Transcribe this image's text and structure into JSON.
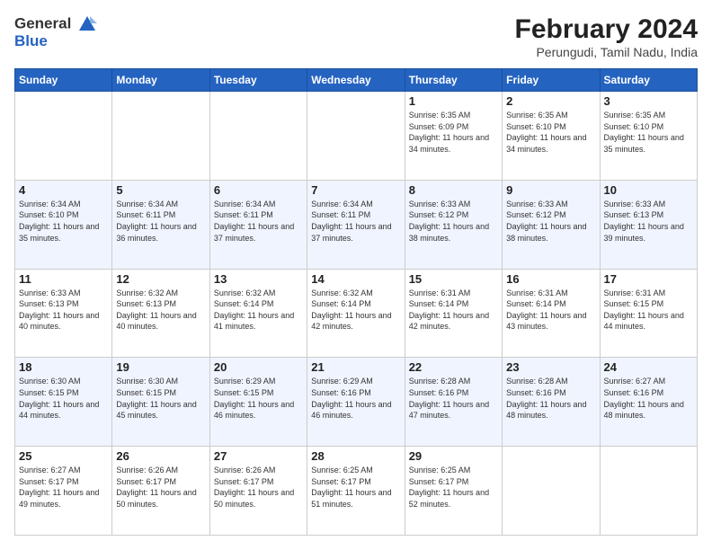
{
  "header": {
    "logo_line1": "General",
    "logo_line2": "Blue",
    "title": "February 2024",
    "subtitle": "Perungudi, Tamil Nadu, India"
  },
  "weekdays": [
    "Sunday",
    "Monday",
    "Tuesday",
    "Wednesday",
    "Thursday",
    "Friday",
    "Saturday"
  ],
  "weeks": [
    [
      {
        "day": "",
        "info": ""
      },
      {
        "day": "",
        "info": ""
      },
      {
        "day": "",
        "info": ""
      },
      {
        "day": "",
        "info": ""
      },
      {
        "day": "1",
        "info": "Sunrise: 6:35 AM\nSunset: 6:09 PM\nDaylight: 11 hours and 34 minutes."
      },
      {
        "day": "2",
        "info": "Sunrise: 6:35 AM\nSunset: 6:10 PM\nDaylight: 11 hours and 34 minutes."
      },
      {
        "day": "3",
        "info": "Sunrise: 6:35 AM\nSunset: 6:10 PM\nDaylight: 11 hours and 35 minutes."
      }
    ],
    [
      {
        "day": "4",
        "info": "Sunrise: 6:34 AM\nSunset: 6:10 PM\nDaylight: 11 hours and 35 minutes."
      },
      {
        "day": "5",
        "info": "Sunrise: 6:34 AM\nSunset: 6:11 PM\nDaylight: 11 hours and 36 minutes."
      },
      {
        "day": "6",
        "info": "Sunrise: 6:34 AM\nSunset: 6:11 PM\nDaylight: 11 hours and 37 minutes."
      },
      {
        "day": "7",
        "info": "Sunrise: 6:34 AM\nSunset: 6:11 PM\nDaylight: 11 hours and 37 minutes."
      },
      {
        "day": "8",
        "info": "Sunrise: 6:33 AM\nSunset: 6:12 PM\nDaylight: 11 hours and 38 minutes."
      },
      {
        "day": "9",
        "info": "Sunrise: 6:33 AM\nSunset: 6:12 PM\nDaylight: 11 hours and 38 minutes."
      },
      {
        "day": "10",
        "info": "Sunrise: 6:33 AM\nSunset: 6:13 PM\nDaylight: 11 hours and 39 minutes."
      }
    ],
    [
      {
        "day": "11",
        "info": "Sunrise: 6:33 AM\nSunset: 6:13 PM\nDaylight: 11 hours and 40 minutes."
      },
      {
        "day": "12",
        "info": "Sunrise: 6:32 AM\nSunset: 6:13 PM\nDaylight: 11 hours and 40 minutes."
      },
      {
        "day": "13",
        "info": "Sunrise: 6:32 AM\nSunset: 6:14 PM\nDaylight: 11 hours and 41 minutes."
      },
      {
        "day": "14",
        "info": "Sunrise: 6:32 AM\nSunset: 6:14 PM\nDaylight: 11 hours and 42 minutes."
      },
      {
        "day": "15",
        "info": "Sunrise: 6:31 AM\nSunset: 6:14 PM\nDaylight: 11 hours and 42 minutes."
      },
      {
        "day": "16",
        "info": "Sunrise: 6:31 AM\nSunset: 6:14 PM\nDaylight: 11 hours and 43 minutes."
      },
      {
        "day": "17",
        "info": "Sunrise: 6:31 AM\nSunset: 6:15 PM\nDaylight: 11 hours and 44 minutes."
      }
    ],
    [
      {
        "day": "18",
        "info": "Sunrise: 6:30 AM\nSunset: 6:15 PM\nDaylight: 11 hours and 44 minutes."
      },
      {
        "day": "19",
        "info": "Sunrise: 6:30 AM\nSunset: 6:15 PM\nDaylight: 11 hours and 45 minutes."
      },
      {
        "day": "20",
        "info": "Sunrise: 6:29 AM\nSunset: 6:15 PM\nDaylight: 11 hours and 46 minutes."
      },
      {
        "day": "21",
        "info": "Sunrise: 6:29 AM\nSunset: 6:16 PM\nDaylight: 11 hours and 46 minutes."
      },
      {
        "day": "22",
        "info": "Sunrise: 6:28 AM\nSunset: 6:16 PM\nDaylight: 11 hours and 47 minutes."
      },
      {
        "day": "23",
        "info": "Sunrise: 6:28 AM\nSunset: 6:16 PM\nDaylight: 11 hours and 48 minutes."
      },
      {
        "day": "24",
        "info": "Sunrise: 6:27 AM\nSunset: 6:16 PM\nDaylight: 11 hours and 48 minutes."
      }
    ],
    [
      {
        "day": "25",
        "info": "Sunrise: 6:27 AM\nSunset: 6:17 PM\nDaylight: 11 hours and 49 minutes."
      },
      {
        "day": "26",
        "info": "Sunrise: 6:26 AM\nSunset: 6:17 PM\nDaylight: 11 hours and 50 minutes."
      },
      {
        "day": "27",
        "info": "Sunrise: 6:26 AM\nSunset: 6:17 PM\nDaylight: 11 hours and 50 minutes."
      },
      {
        "day": "28",
        "info": "Sunrise: 6:25 AM\nSunset: 6:17 PM\nDaylight: 11 hours and 51 minutes."
      },
      {
        "day": "29",
        "info": "Sunrise: 6:25 AM\nSunset: 6:17 PM\nDaylight: 11 hours and 52 minutes."
      },
      {
        "day": "",
        "info": ""
      },
      {
        "day": "",
        "info": ""
      }
    ]
  ]
}
